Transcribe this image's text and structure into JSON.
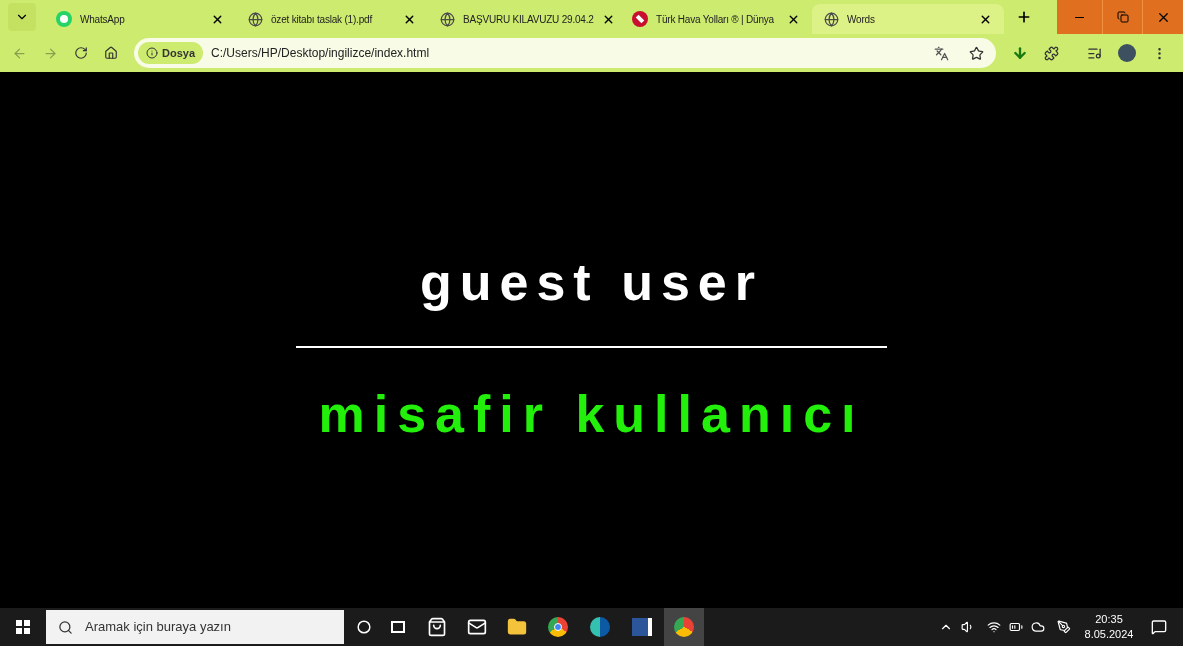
{
  "tabs": [
    {
      "title": "WhatsApp",
      "kind": "whatsapp",
      "selected": false
    },
    {
      "title": "özet kitabı taslak (1).pdf",
      "kind": "globe",
      "selected": false
    },
    {
      "title": "BAŞVURU KILAVUZU 29.04.2",
      "kind": "globe",
      "selected": false
    },
    {
      "title": "Türk Hava Yolları ® | Dünya",
      "kind": "airline",
      "selected": false
    },
    {
      "title": "Words",
      "kind": "globe",
      "selected": true
    }
  ],
  "address_bar": {
    "badge": "Dosya",
    "url": "C:/Users/HP/Desktop/ingilizce/index.html"
  },
  "page": {
    "heading": "guest user",
    "translation": "misafir kullanıcı"
  },
  "taskbar": {
    "search_placeholder": "Aramak için buraya yazın",
    "time": "20:35",
    "date": "8.05.2024"
  }
}
